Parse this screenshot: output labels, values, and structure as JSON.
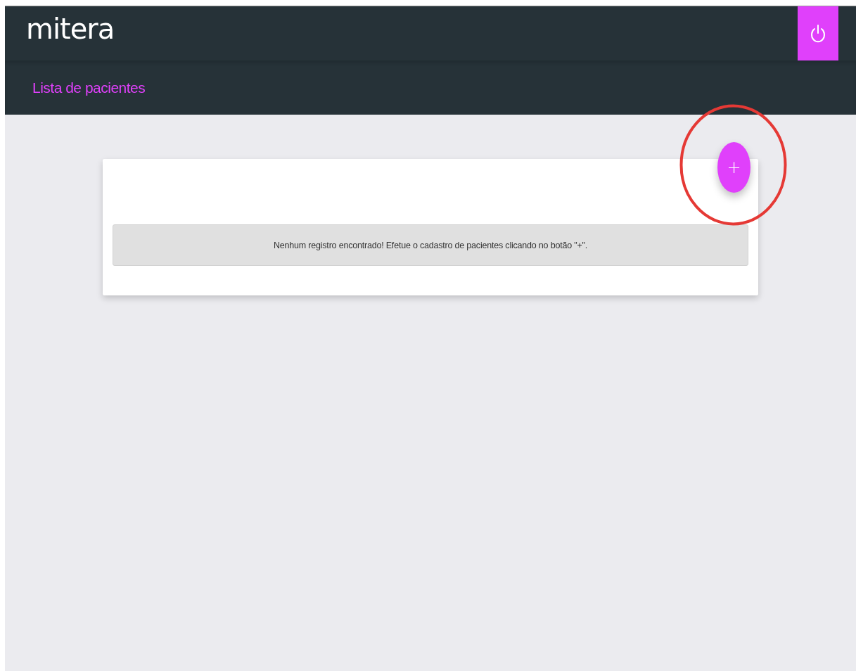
{
  "header": {
    "logo": "mitera"
  },
  "subheader": {
    "title": "Lista de pacientes"
  },
  "card": {
    "add_button": {
      "label": "+",
      "highlighted": true
    },
    "empty_message": "Nenhum registro encontrado! Efetue o cadastro de pacientes clicando no botão \"+\"."
  }
}
